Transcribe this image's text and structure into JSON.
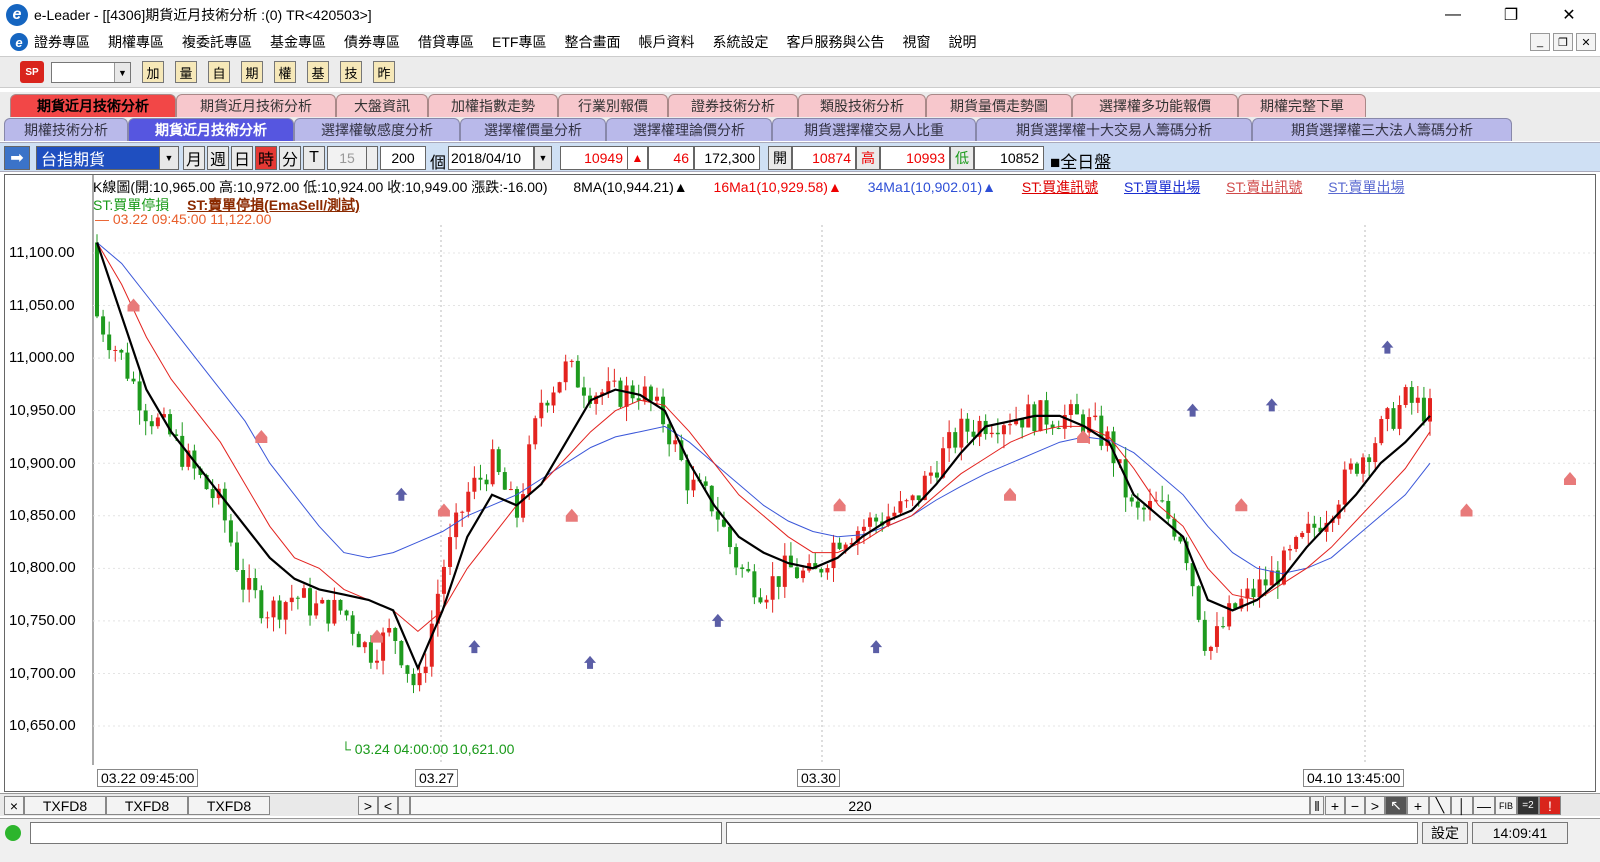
{
  "window": {
    "title": "e-Leader - [[4306]期貨近月技術分析 :(0) TR<420503>]"
  },
  "menu": [
    "證券專區",
    "期權專區",
    "複委託專區",
    "基金專區",
    "債券專區",
    "借貸專區",
    "ETF專區",
    "整合畫面",
    "帳戶資料",
    "系統設定",
    "客戶服務與公告",
    "視窗",
    "說明"
  ],
  "toolbar": {
    "buttons": [
      "加",
      "量",
      "自",
      "期",
      "權",
      "基",
      "技",
      "昨"
    ]
  },
  "tabs_row1": [
    "期貨近月技術分析",
    "期貨近月技術分析",
    "大盤資訊",
    "加權指數走勢",
    "行業別報價",
    "證券技術分析",
    "類股技術分析",
    "期貨量價走勢圖",
    "選擇權多功能報價",
    "期權完整下單"
  ],
  "tabs_row2": [
    "期權技術分析",
    "期貨近月技術分析",
    "選擇權敏感度分析",
    "選擇權價量分析",
    "選擇權理論價分析",
    "期貨選擇權交易人比重",
    "期貨選擇權十大交易人籌碼分析",
    "期貨選擇權三大法人籌碼分析"
  ],
  "controls": {
    "symbol": "台指期貨",
    "periods": [
      "月",
      "週",
      "日",
      "時",
      "分",
      "T"
    ],
    "minutes": "15",
    "count": "200",
    "count_unit": "個",
    "date": "2018/04/10",
    "price": "10949",
    "change": "46",
    "volume": "172,300",
    "open_label": "開",
    "open": "10874",
    "high_label": "高",
    "high": "10993",
    "low_label": "低",
    "low": "10852",
    "fullday": "■全日盤"
  },
  "legend": {
    "kline": "K線圖(開:10,965.00 高:10,972.00 低:10,924.00 收:10,949.00 漲跌:-16.00)",
    "ma8": "8MA(10,944.21)▲",
    "ma16": "16Ma1(10,929.58)▲",
    "ma34": "34Ma1(10,902.01)▲",
    "st_buy_signal": "ST:買進訊號",
    "st_buy_exit": "ST:買單出場",
    "st_sell_signal": "ST:賣出訊號",
    "st_sell_exit": "ST:賣單出場",
    "st_buy_stop": "ST:買單停損",
    "st_sell_stop": "ST:賣單停損(EmaSell/測試)",
    "high_note": "— 03.22 09:45:00  11,122.00",
    "low_note": "└ 03.24 04:00:00  10,621.00"
  },
  "chart_data": {
    "type": "candlestick",
    "y_ticks": [
      "11,100.00",
      "11,050.00",
      "11,000.00",
      "10,950.00",
      "10,900.00",
      "10,850.00",
      "10,800.00",
      "10,750.00",
      "10,700.00",
      "10,650.00"
    ],
    "ylim": [
      10620,
      11140
    ],
    "x_labels": [
      "03.22 09:45:00",
      "03.27",
      "03.30",
      "04.10 13:45:00"
    ],
    "ma8": [
      11110,
      11040,
      10970,
      10930,
      10900,
      10870,
      10840,
      10810,
      10790,
      10780,
      10775,
      10770,
      10760,
      10705,
      10760,
      10830,
      10870,
      10860,
      10880,
      10920,
      10960,
      10970,
      10965,
      10950,
      10900,
      10860,
      10830,
      10815,
      10805,
      10800,
      10810,
      10830,
      10845,
      10855,
      10880,
      10910,
      10935,
      10940,
      10945,
      10945,
      10935,
      10920,
      10870,
      10850,
      10830,
      10770,
      10760,
      10770,
      10790,
      10820,
      10845,
      10870,
      10900,
      10920,
      10945
    ],
    "ma16": [
      11110,
      11070,
      11020,
      10980,
      10950,
      10920,
      10880,
      10840,
      10810,
      10800,
      10780,
      10770,
      10760,
      10740,
      10760,
      10800,
      10830,
      10860,
      10880,
      10905,
      10930,
      10950,
      10960,
      10955,
      10930,
      10900,
      10870,
      10850,
      10830,
      10815,
      10815,
      10825,
      10840,
      10850,
      10870,
      10890,
      10905,
      10920,
      10930,
      10935,
      10935,
      10925,
      10895,
      10860,
      10840,
      10800,
      10775,
      10770,
      10785,
      10800,
      10820,
      10845,
      10870,
      10895,
      10930
    ],
    "ma34": [
      11110,
      11090,
      11060,
      11030,
      11000,
      10970,
      10940,
      10900,
      10870,
      10840,
      10815,
      10810,
      10815,
      10825,
      10835,
      10850,
      10860,
      10870,
      10885,
      10900,
      10915,
      10925,
      10930,
      10935,
      10920,
      10900,
      10880,
      10860,
      10845,
      10835,
      10830,
      10832,
      10840,
      10850,
      10865,
      10878,
      10890,
      10900,
      10910,
      10920,
      10925,
      10922,
      10910,
      10890,
      10870,
      10840,
      10815,
      10800,
      10795,
      10800,
      10810,
      10830,
      10850,
      10870,
      10900
    ],
    "closes": [
      11040,
      11000,
      10950,
      10925,
      10890,
      10860,
      10780,
      10760,
      10775,
      10760,
      10760,
      10720,
      10740,
      10680,
      10800,
      10870,
      10900,
      10850,
      10960,
      10990,
      10970,
      10965,
      10970,
      10940,
      10880,
      10860,
      10800,
      10780,
      10800,
      10790,
      10830,
      10840,
      10850,
      10860,
      10900,
      10930,
      10940,
      10945,
      10945,
      10945,
      10940,
      10920,
      10850,
      10860,
      10830,
      10720,
      10760,
      10780,
      10800,
      10830,
      10860,
      10900,
      10930,
      10960,
      10949
    ],
    "buy_markers": [
      [
        50,
        10870
      ],
      [
        62,
        10725
      ],
      [
        81,
        10710
      ],
      [
        102,
        10750
      ],
      [
        128,
        10725
      ],
      [
        180,
        10950
      ],
      [
        193,
        10955
      ],
      [
        212,
        11010
      ]
    ],
    "sell_markers": [
      [
        6,
        11050
      ],
      [
        27,
        10925
      ],
      [
        46,
        10735
      ],
      [
        57,
        10855
      ],
      [
        78,
        10850
      ],
      [
        122,
        10860
      ],
      [
        150,
        10870
      ],
      [
        162,
        10925
      ],
      [
        188,
        10860
      ],
      [
        225,
        10855
      ],
      [
        242,
        10885
      ]
    ]
  },
  "bottombar": {
    "tabs": [
      "TXFD8",
      "TXFD8",
      "TXFD8"
    ],
    "center": "220"
  },
  "statusbar": {
    "settings": "設定",
    "time": "14:09:41"
  }
}
